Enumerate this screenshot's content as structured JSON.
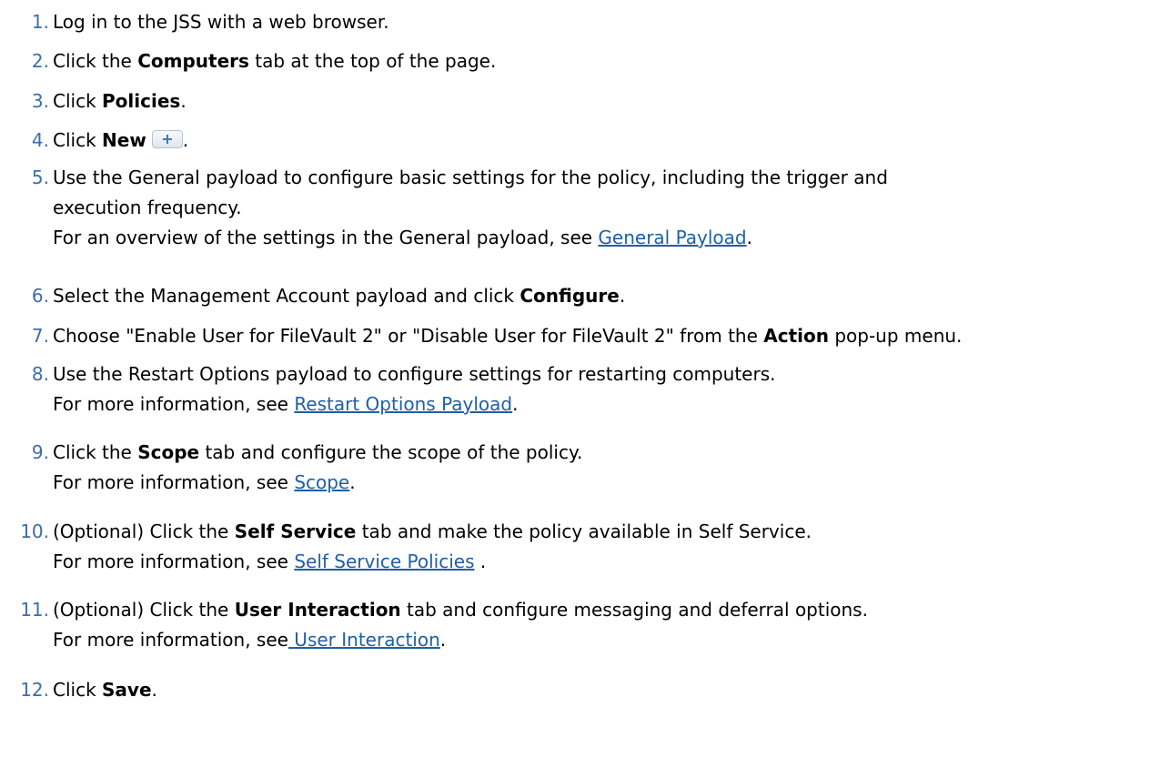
{
  "steps": [
    {
      "num": "1.",
      "pre": "Log in to the JSS with a web browser."
    },
    {
      "num": "2.",
      "pre": "Click the ",
      "bold": "Computers",
      "post": " tab at the top of the page."
    },
    {
      "num": "3.",
      "pre": "Click ",
      "bold": "Policies",
      "post": "."
    },
    {
      "num": "4.",
      "pre": "Click ",
      "bold": "New",
      "post": ".",
      "button_icon": "plus-icon"
    },
    {
      "num": "5.",
      "pre": "Use the General payload to configure basic settings for the policy, including the trigger and",
      "line2": "execution frequency.",
      "info": "For an overview of the settings in the General payload, see ",
      "link": "General Payload",
      "info_post": "."
    },
    {
      "num": "6.",
      "pre": "Select the Management Account payload and click ",
      "bold": "Configure",
      "post": "."
    },
    {
      "num": "7.",
      "pre": "Choose \"Enable User for FileVault 2\" or \"Disable User for FileVault 2\" from the ",
      "bold": "Action",
      "post": " pop-up menu."
    },
    {
      "num": "8.",
      "pre": "Use the Restart Options payload to configure settings for restarting computers.",
      "info": "For more information, see ",
      "link": "Restart Options Payload",
      "info_post": "."
    },
    {
      "num": "9.",
      "pre": "Click the ",
      "bold": "Scope",
      "post": " tab and configure the scope of the policy.",
      "info": "For more information, see ",
      "link": "Scope",
      "info_post": "."
    },
    {
      "num": "10.",
      "pre": "(Optional) Click the ",
      "bold": "Self Service",
      "post": " tab and make the policy available in Self Service.",
      "info": "For more information, see ",
      "link": "Self Service Policies",
      "info_post": " ."
    },
    {
      "num": "11.",
      "pre": "(Optional) Click the ",
      "bold": "User Interaction",
      "post": " tab and configure messaging and deferral options.",
      "info": "For more information, see",
      "link": " User Interaction",
      "info_post": "."
    },
    {
      "num": "12.",
      "pre": "Click ",
      "bold": "Save",
      "post": "."
    }
  ],
  "colors": {
    "step_number": "#3d6ea8",
    "link": "#1f5fa8",
    "plus_button": "#3e78bd"
  }
}
